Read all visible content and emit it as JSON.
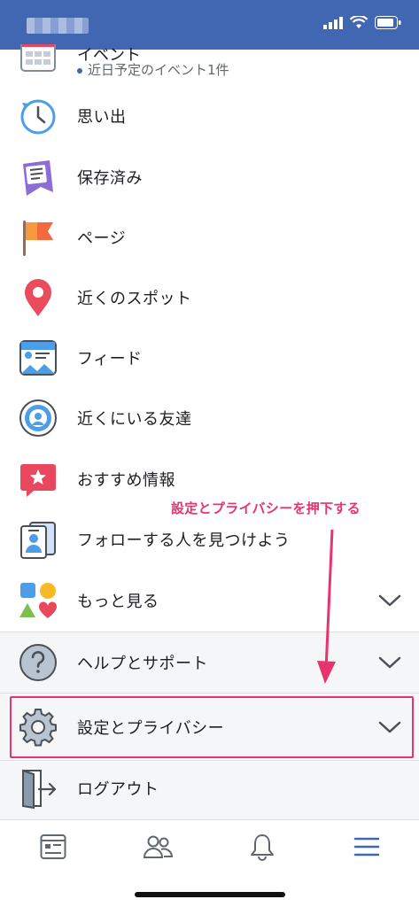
{
  "status_bar": {
    "color": "#4267b2",
    "carrier": "",
    "icons": [
      "signal-icon",
      "wifi-icon",
      "battery-icon"
    ]
  },
  "event_item": {
    "title": "イベント",
    "subtitle": "近日予定のイベント1件"
  },
  "menu_items": [
    {
      "key": "memories",
      "label": "思い出",
      "icon": "clock-memories-icon"
    },
    {
      "key": "saved",
      "label": "保存済み",
      "icon": "bookmark-saved-icon"
    },
    {
      "key": "pages",
      "label": "ページ",
      "icon": "flag-pages-icon"
    },
    {
      "key": "nearby-places",
      "label": "近くのスポット",
      "icon": "map-pin-icon"
    },
    {
      "key": "feeds",
      "label": "フィード",
      "icon": "feed-icon"
    },
    {
      "key": "nearby-friends",
      "label": "近くにいる友達",
      "icon": "nearby-friends-icon"
    },
    {
      "key": "recommendations",
      "label": "おすすめ情報",
      "icon": "star-bubble-icon"
    },
    {
      "key": "find-friends",
      "label": "フォローする人を見つけよう",
      "icon": "id-card-icon"
    },
    {
      "key": "see-more",
      "label": "もっと見る",
      "icon": "shapes-icon"
    }
  ],
  "sections": [
    {
      "key": "help",
      "label": "ヘルプとサポート",
      "icon": "question-icon"
    },
    {
      "key": "settings",
      "label": "設定とプライバシー",
      "icon": "gear-icon"
    }
  ],
  "logout": {
    "label": "ログアウト",
    "icon": "logout-door-icon"
  },
  "annotation": {
    "text": "設定とプライバシーを押下する",
    "color": "#e8336c"
  },
  "tab_bar": {
    "tabs": [
      "news-feed-tab-icon",
      "friends-tab-icon",
      "notifications-tab-icon",
      "menu-tab-icon"
    ],
    "active_color": "#4267b2"
  }
}
